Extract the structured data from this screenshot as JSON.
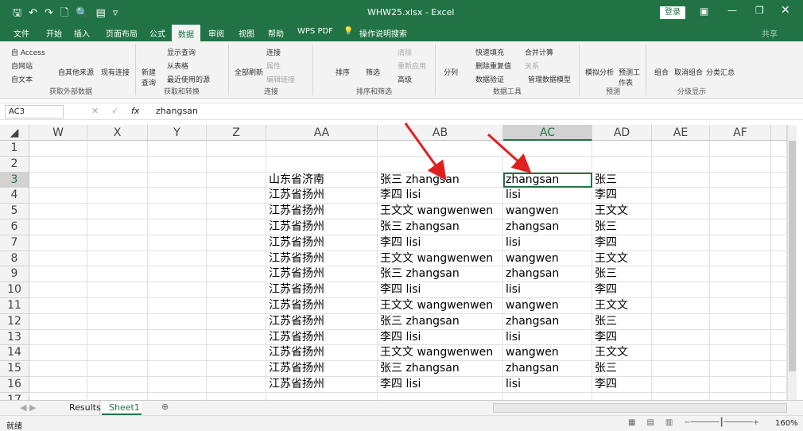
{
  "title_bar": {
    "filename": "WHW25.xlsx  -  Excel",
    "login": "登录",
    "qat_icons": [
      "save-icon",
      "undo-icon",
      "redo-icon",
      "new-icon",
      "print-preview-icon",
      "form-icon",
      "customize-icon"
    ]
  },
  "tabs": [
    {
      "label": "文件"
    },
    {
      "label": "开始"
    },
    {
      "label": "插入"
    },
    {
      "label": "页面布局"
    },
    {
      "label": "公式"
    },
    {
      "label": "数据",
      "active": true
    },
    {
      "label": "审阅"
    },
    {
      "label": "视图"
    },
    {
      "label": "帮助"
    },
    {
      "label": "WPS PDF"
    },
    {
      "label": "操作说明搜索"
    }
  ],
  "share": "共享",
  "ribbon": {
    "get_external": {
      "access": "自 Access",
      "web": "自网站",
      "text": "自文本",
      "other": "自其他来源",
      "existing": "现有连接",
      "label": "获取外部数据"
    },
    "get_transform": {
      "new_query": "新建查询",
      "show_query": "显示查询",
      "from_table": "从表格",
      "recent": "最近使用的源",
      "label": "获取和转换"
    },
    "connections": {
      "refresh_all": "全部刷新",
      "connections": "连接",
      "properties": "属性",
      "edit_links": "编辑链接",
      "label": "连接"
    },
    "sort_filter": {
      "sort": "排序",
      "filter": "筛选",
      "clear": "清除",
      "reapply": "重新应用",
      "advanced": "高级",
      "label": "排序和筛选"
    },
    "data_tools": {
      "split": "分列",
      "flash_fill": "快速填充",
      "remove_dup": "删除重复值",
      "validation": "数据验证",
      "consolidate": "合并计算",
      "relations": "关系",
      "data_model": "管理数据模型",
      "label": "数据工具"
    },
    "forecast": {
      "whatif": "模拟分析",
      "sheet": "预测工作表",
      "label": "预测"
    },
    "outline": {
      "group": "组合",
      "ungroup": "取消组合",
      "subtotal": "分类汇总",
      "label": "分级显示"
    }
  },
  "formula_bar": {
    "name_box": "AC3",
    "fx": "fx",
    "value": "zhangsan"
  },
  "columns": [
    "W",
    "X",
    "Y",
    "Z",
    "AA",
    "AB",
    "AC",
    "AD",
    "AE",
    "AF"
  ],
  "selected_column": "AC",
  "rows": [
    {
      "n": "1",
      "aa": "",
      "ab": "",
      "ac": "",
      "ad": ""
    },
    {
      "n": "2",
      "aa": "",
      "ab": "",
      "ac": "",
      "ad": ""
    },
    {
      "n": "3",
      "aa": "山东省济南",
      "ab": "张三 zhangsan",
      "ac": "zhangsan",
      "ad": "张三"
    },
    {
      "n": "4",
      "aa": "江苏省扬州",
      "ab": "李四 lisi",
      "ac": "lisi",
      "ad": "李四"
    },
    {
      "n": "5",
      "aa": "江苏省扬州",
      "ab": "王文文 wangwenwen",
      "ac": "wangwen",
      "ad": "王文文"
    },
    {
      "n": "6",
      "aa": "江苏省扬州",
      "ab": "张三 zhangsan",
      "ac": "zhangsan",
      "ad": "张三"
    },
    {
      "n": "7",
      "aa": "江苏省扬州",
      "ab": "李四 lisi",
      "ac": "lisi",
      "ad": "李四"
    },
    {
      "n": "8",
      "aa": "江苏省扬州",
      "ab": "王文文 wangwenwen",
      "ac": "wangwen",
      "ad": "王文文"
    },
    {
      "n": "9",
      "aa": "江苏省扬州",
      "ab": "张三 zhangsan",
      "ac": "zhangsan",
      "ad": "张三"
    },
    {
      "n": "10",
      "aa": "江苏省扬州",
      "ab": "李四 lisi",
      "ac": "lisi",
      "ad": "李四"
    },
    {
      "n": "11",
      "aa": "江苏省扬州",
      "ab": "王文文 wangwenwen",
      "ac": "wangwen",
      "ad": "王文文"
    },
    {
      "n": "12",
      "aa": "江苏省扬州",
      "ab": "张三 zhangsan",
      "ac": "zhangsan",
      "ad": "张三"
    },
    {
      "n": "13",
      "aa": "江苏省扬州",
      "ab": "李四 lisi",
      "ac": "lisi",
      "ad": "李四"
    },
    {
      "n": "14",
      "aa": "江苏省扬州",
      "ab": "王文文 wangwenwen",
      "ac": "wangwen",
      "ad": "王文文"
    },
    {
      "n": "15",
      "aa": "江苏省扬州",
      "ab": "张三 zhangsan",
      "ac": "zhangsan",
      "ad": "张三"
    },
    {
      "n": "16",
      "aa": "江苏省扬州",
      "ab": "李四 lisi",
      "ac": "lisi",
      "ad": "李四"
    },
    {
      "n": "17",
      "aa": "",
      "ab": "",
      "ac": "",
      "ad": ""
    }
  ],
  "sheets": [
    {
      "label": "Results"
    },
    {
      "label": "Sheet1",
      "active": true
    }
  ],
  "status": {
    "ready": "就绪",
    "zoom": "160%"
  },
  "colors": {
    "accent": "#217346",
    "arrow": "#e02020"
  }
}
